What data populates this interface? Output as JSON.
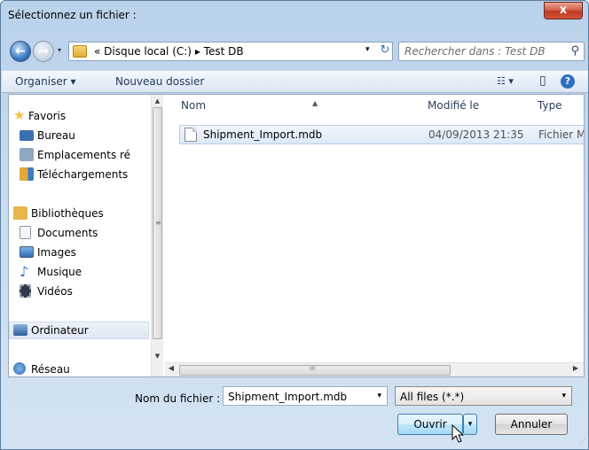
{
  "dialog": {
    "title": "Sélectionnez un fichier :",
    "close_label": "x"
  },
  "nav": {
    "recent_glyph": "▾",
    "path_prefix": "«",
    "path_location": "Disque local (C:)",
    "path_separator": "▸",
    "path_folder": "Test DB",
    "address_dropdown": "▾",
    "refresh_glyph": "↻",
    "search_placeholder": "Rechercher dans : Test DB",
    "search_glyph": "⚲"
  },
  "toolbar": {
    "organize_label": "Organiser ▾",
    "new_folder_label": "Nouveau dossier",
    "view_glyph": "☷ ▾",
    "preview_glyph": "▯",
    "help_glyph": "?"
  },
  "sidebar": {
    "items": [
      {
        "label": "Favoris",
        "icon": "star-icon",
        "color": "#f2c23a"
      },
      {
        "label": "Bureau",
        "icon": "desktop-icon",
        "color": "#3b6fb4"
      },
      {
        "label": "Emplacements ré",
        "icon": "recent-places-icon",
        "color": "#8fa7c2"
      },
      {
        "label": "Téléchargements",
        "icon": "downloads-icon",
        "color": "#e5a83a"
      },
      {
        "label": "Bibliothèques",
        "icon": "library-icon",
        "color": "#e8b64a"
      },
      {
        "label": "Documents",
        "icon": "document-icon",
        "color": "#d7dde6"
      },
      {
        "label": "Images",
        "icon": "image-icon",
        "color": "#4d86c6"
      },
      {
        "label": "Musique",
        "icon": "music-icon",
        "color": "#3a76c4"
      },
      {
        "label": "Vidéos",
        "icon": "video-icon",
        "color": "#303a48"
      },
      {
        "label": "Ordinateur",
        "icon": "computer-icon",
        "color": "#5b7ea6"
      },
      {
        "label": "Réseau",
        "icon": "network-icon",
        "color": "#3e7cc7"
      }
    ]
  },
  "files": {
    "columns": [
      "Nom",
      "Modifié le",
      "Type"
    ],
    "sort_indicator": "▲",
    "rows": [
      {
        "name": "Shipment_Import.mdb",
        "modified": "04/09/2013 21:35",
        "type": "Fichier MD"
      }
    ]
  },
  "scroll": {
    "up": "▲",
    "down": "▼",
    "left": "◀",
    "right": "▶",
    "grip": "≡",
    "h_grip": "III"
  },
  "footer": {
    "filename_label": "Nom du fichier :",
    "filename_value": "Shipment_Import.mdb",
    "filename_dropdown": "▾",
    "filter_value": "All files (*.*)",
    "filter_dropdown": "▾",
    "open_label": "Ouvrir",
    "open_dropdown": "▾",
    "cancel_label": "Annuler",
    "resize_grip": "⋰"
  },
  "colors": {
    "accent": "#3c7fb1",
    "selection": "#dde9f7"
  }
}
